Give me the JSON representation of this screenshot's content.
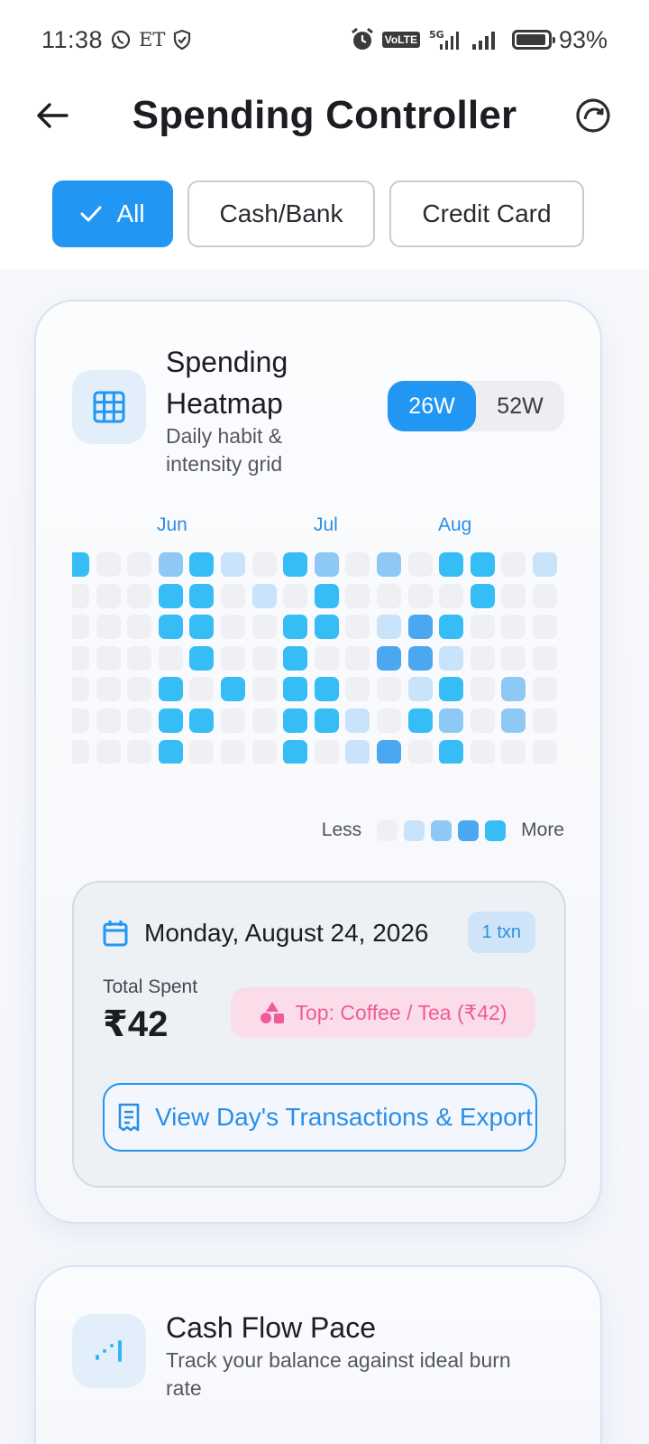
{
  "status_bar": {
    "time": "11:38",
    "carrier_text": "ET",
    "volte": "VoLTE",
    "network": "5G",
    "battery_level": 0.93,
    "battery_text": "93%"
  },
  "header": {
    "title": "Spending Controller",
    "back_icon": "arrow-left-icon",
    "refresh_icon": "refresh-icon"
  },
  "filters": {
    "items": [
      {
        "label": "All",
        "selected": true
      },
      {
        "label": "Cash/Bank",
        "selected": false
      },
      {
        "label": "Credit Card",
        "selected": false
      }
    ]
  },
  "heatmap_card": {
    "title_line1": "Spending",
    "title_line2": "Heatmap",
    "subtitle_line1": "Daily habit &",
    "subtitle_line2": "intensity grid",
    "icon": "grid-icon",
    "range_toggle": {
      "options": [
        "26W",
        "52W"
      ],
      "selected": "26W"
    },
    "months": [
      "Jun",
      "Jul",
      "Aug"
    ],
    "legend": {
      "less": "Less",
      "more": "More"
    },
    "colors": {
      "empty": "#eef0f4",
      "level1": "#c8e3fa",
      "level2": "#8ec8f5",
      "level3": "#4ba7ef",
      "level4": "#36bdf5"
    },
    "grid": [
      [
        4,
        0,
        0,
        2,
        4,
        1,
        0,
        4,
        2,
        0,
        2,
        0,
        4,
        4,
        0,
        1
      ],
      [
        0,
        0,
        0,
        4,
        4,
        0,
        1,
        0,
        4,
        0,
        0,
        0,
        0,
        4,
        0,
        0
      ],
      [
        0,
        0,
        0,
        4,
        4,
        0,
        0,
        4,
        4,
        0,
        1,
        3,
        4,
        0,
        0,
        0
      ],
      [
        0,
        0,
        0,
        0,
        4,
        0,
        0,
        4,
        0,
        0,
        3,
        3,
        1,
        0,
        0,
        0
      ],
      [
        0,
        0,
        0,
        4,
        0,
        4,
        0,
        4,
        4,
        0,
        0,
        1,
        4,
        0,
        2,
        0
      ],
      [
        0,
        0,
        0,
        4,
        4,
        0,
        0,
        4,
        4,
        1,
        0,
        4,
        2,
        0,
        2,
        0
      ],
      [
        0,
        0,
        0,
        4,
        0,
        0,
        0,
        4,
        0,
        1,
        3,
        0,
        4,
        0,
        0,
        0
      ]
    ],
    "selected_day": {
      "date": "Monday, August 24, 2026",
      "txn_count": "1 txn",
      "total_label": "Total Spent",
      "total_value": "₹42",
      "top_category": "Top: Coffee / Tea (₹42)",
      "action_label": "View Day's Transactions & Export"
    }
  },
  "cashflow_card": {
    "title": "Cash Flow Pace",
    "subtitle_line1": "Track your balance against ideal burn",
    "subtitle_line2": "rate",
    "icon": "chart-trend-icon"
  }
}
